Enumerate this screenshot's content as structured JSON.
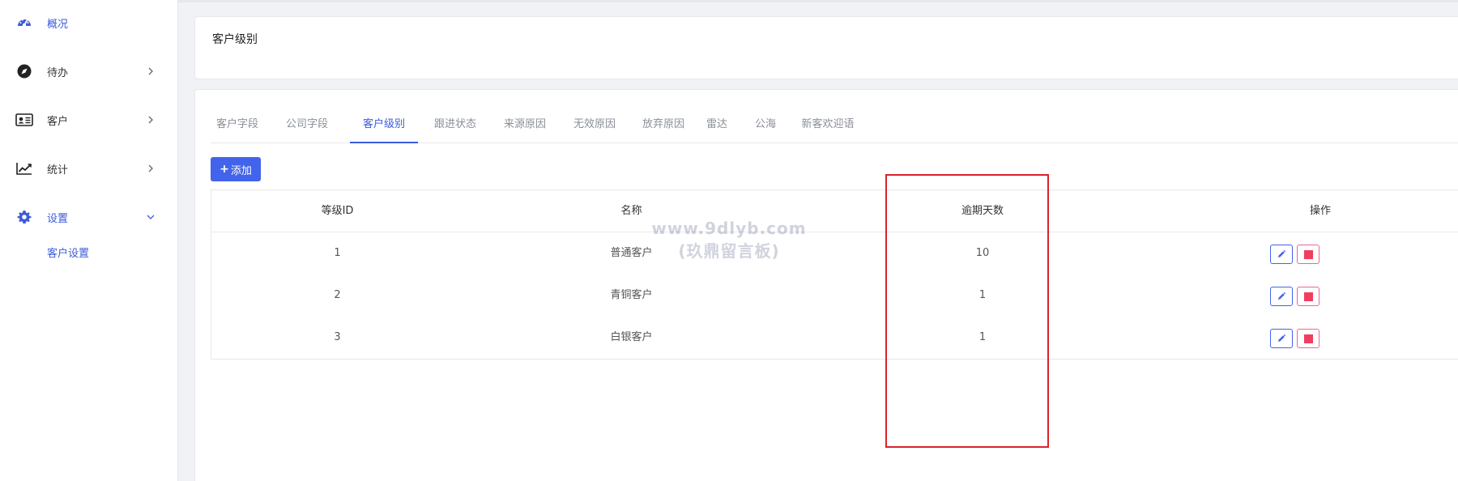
{
  "sidebar": {
    "items": [
      {
        "label": "概况",
        "icon": "dashboard-icon"
      },
      {
        "label": "待办",
        "icon": "compass-icon"
      },
      {
        "label": "客户",
        "icon": "id-card-icon"
      },
      {
        "label": "统计",
        "icon": "line-chart-icon"
      },
      {
        "label": "设置",
        "icon": "gear-icon"
      }
    ],
    "sub_items": [
      {
        "label": "客户设置"
      }
    ]
  },
  "header": {
    "title": "客户级别"
  },
  "tabs": [
    {
      "label": "客户字段"
    },
    {
      "label": "公司字段"
    },
    {
      "label": "客户级别"
    },
    {
      "label": "跟进状态"
    },
    {
      "label": "来源原因"
    },
    {
      "label": "无效原因"
    },
    {
      "label": "放弃原因"
    },
    {
      "label": "雷达"
    },
    {
      "label": "公海"
    },
    {
      "label": "新客欢迎语"
    }
  ],
  "toolbar": {
    "add_label": "添加"
  },
  "table": {
    "columns": [
      "等级ID",
      "名称",
      "逾期天数",
      "操作"
    ],
    "rows": [
      {
        "id": "1",
        "name": "普通客户",
        "overdue_days": "10"
      },
      {
        "id": "2",
        "name": "青铜客户",
        "overdue_days": "1"
      },
      {
        "id": "3",
        "name": "白银客户",
        "overdue_days": "1"
      }
    ]
  },
  "watermark": {
    "line1": "www.9dlyb.com",
    "line2": "(玖鼎留言板)"
  },
  "colors": {
    "accent": "#4263eb",
    "danger": "#f03e5e",
    "highlight": "#d9232d"
  }
}
